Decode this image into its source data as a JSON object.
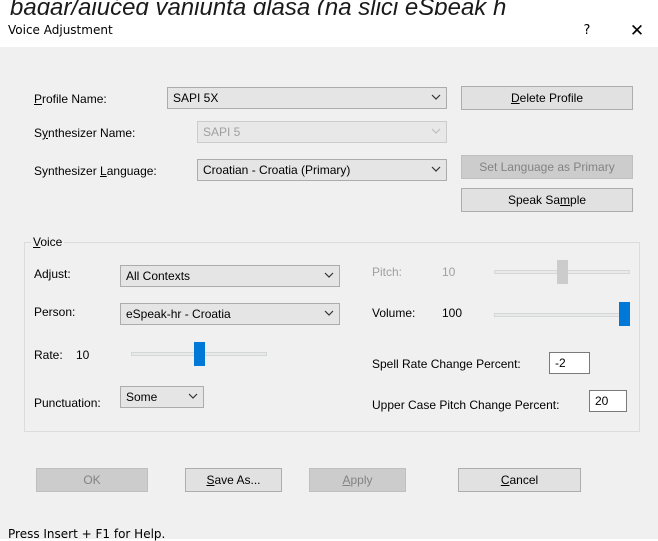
{
  "background_text": "bagar/ajućeg vanjunta glasa (na slici eSpeak h",
  "window": {
    "title": "Voice Adjustment",
    "help_glyph": "?",
    "close_glyph": "✕"
  },
  "profile": {
    "profile_name_label": "Profile Name:",
    "profile_name_value": "SAPI 5X",
    "delete_profile_label": "Delete Profile",
    "synth_name_label": "Synthesizer Name:",
    "synth_name_value": "SAPI 5",
    "synth_language_label": "Synthesizer Language:",
    "synth_language_value": "Croatian - Croatia (Primary)",
    "set_language_primary_label": "Set Language as Primary",
    "speak_sample_label": "Speak Sample"
  },
  "voice": {
    "group_label": "Voice",
    "adjust_label": "Adjust:",
    "adjust_value": "All Contexts",
    "person_label": "Person:",
    "person_value": "eSpeak-hr - Croatia",
    "rate_label": "Rate:",
    "rate_value": "10",
    "rate_level_percent": 50,
    "punctuation_label": "Punctuation:",
    "punctuation_value": "Some",
    "pitch_label": "Pitch:",
    "pitch_value": "10",
    "pitch_level_percent": 50,
    "volume_label": "Volume:",
    "volume_value": "100",
    "volume_level_percent": 100,
    "spell_rate_label": "Spell Rate Change Percent:",
    "spell_rate_value": "-2",
    "upper_case_pitch_label": "Upper Case Pitch Change Percent:",
    "upper_case_pitch_value": "20"
  },
  "buttons": {
    "ok": "OK",
    "save_as": "Save As...",
    "apply": "Apply",
    "cancel": "Cancel"
  },
  "status": {
    "text": "Press Insert + F1 for Help."
  }
}
